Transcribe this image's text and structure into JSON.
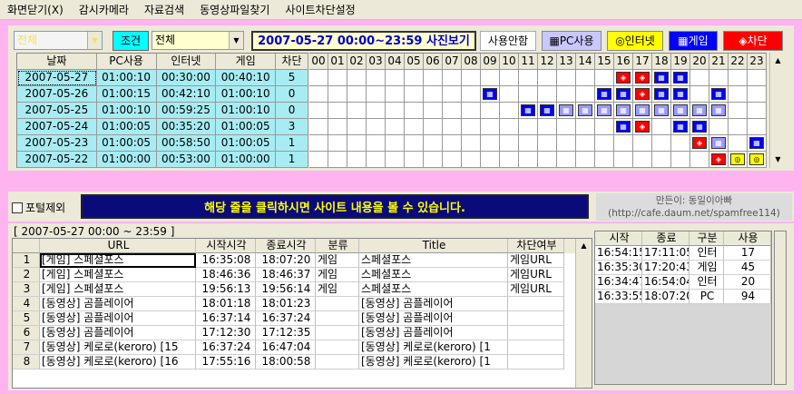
{
  "menu": [
    "화면닫기(X)",
    "감시카메라",
    "자료검색",
    "동영상파일찾기",
    "사이트차단설정"
  ],
  "toolbar": {
    "filter_value": "전체",
    "condition_label": "조건",
    "condition_value": "전체",
    "date_range": "2007-05-27 00:00~23:59 사진보기",
    "legend_none": "사용안함",
    "legend_pc": "PC사용",
    "legend_internet": "인터넷",
    "legend_game": "게임",
    "legend_block": "차단"
  },
  "colors": {
    "pc": "#9999ff",
    "internet": "#ffff00",
    "game": "#0000ff",
    "block": "#ff0000",
    "date_cell": "#a7ecf3",
    "banner": "#0a0a7a"
  },
  "summary": {
    "headers": [
      "날짜",
      "PC사용",
      "인터넷",
      "게임",
      "차단"
    ],
    "rows": [
      [
        "2007-05-27",
        "01:00:10",
        "00:30:00",
        "00:40:10",
        "5"
      ],
      [
        "2007-05-26",
        "01:00:15",
        "00:42:10",
        "01:00:10",
        "0"
      ],
      [
        "2007-05-25",
        "01:00:10",
        "00:59:25",
        "01:00:10",
        "0"
      ],
      [
        "2007-05-24",
        "01:00:05",
        "00:35:20",
        "01:00:05",
        "3"
      ],
      [
        "2007-05-23",
        "01:00:05",
        "00:58:50",
        "01:00:05",
        "1"
      ],
      [
        "2007-05-22",
        "01:00:00",
        "00:53:00",
        "01:00:00",
        "1"
      ]
    ]
  },
  "hours": [
    "00",
    "01",
    "02",
    "03",
    "04",
    "05",
    "06",
    "07",
    "08",
    "09",
    "10",
    "11",
    "12",
    "13",
    "14",
    "15",
    "16",
    "17",
    "18",
    "19",
    "20",
    "21",
    "22",
    "23"
  ],
  "hour_marks": [
    {
      "16": "block",
      "17": "block",
      "18": "game",
      "19": "game"
    },
    {
      "09": "game",
      "15": "game",
      "16": "game",
      "17": "block",
      "18": "game",
      "19": "game",
      "21": "game"
    },
    {
      "11": "game",
      "12": "game",
      "13": "pc",
      "14": "pc",
      "15": "pc",
      "16": "pc",
      "17": "pc",
      "18": "pc",
      "19": "pc",
      "20": "pc",
      "21": "pc"
    },
    {
      "16": "game",
      "17": "block",
      "19": "game",
      "20": "game"
    },
    {
      "20": "block",
      "21": "pc",
      "23": "game"
    },
    {
      "21": "block",
      "22": "internet",
      "23": "internet"
    }
  ],
  "portal_exclude": "포털제외",
  "banner": "해당 줄을 클릭하시면 사이트 내용을 볼 수 있습니다.",
  "author_line1": "만든이: 동일이아빠",
  "author_line2": "(http://cafe.daum.net/spamfree114)",
  "detail": {
    "range_label": "[ 2007-05-27 00:00 ~ 23:59 ]",
    "headers": [
      "",
      "URL",
      "시작시각",
      "종료시각",
      "분류",
      "Title",
      "차단여부"
    ],
    "rows": [
      [
        "1",
        "[게임] 스페셜포스",
        "16:35:08",
        "18:07:20",
        "게임",
        "스페셜포스",
        "게임URL"
      ],
      [
        "2",
        "[게임] 스페셜포스",
        "18:46:36",
        "18:46:37",
        "게임",
        "스페셜포스",
        "게임URL"
      ],
      [
        "3",
        "[게임] 스페셜포스",
        "19:56:13",
        "19:56:14",
        "게임",
        "스페셜포스",
        "게임URL"
      ],
      [
        "4",
        "[동영상] 곰플레이어",
        "18:01:18",
        "18:01:23",
        "",
        "[동영상] 곰플레이어",
        ""
      ],
      [
        "5",
        "[동영상] 곰플레이어",
        "16:37:14",
        "16:37:24",
        "",
        "[동영상] 곰플레이어",
        ""
      ],
      [
        "6",
        "[동영상] 곰플레이어",
        "17:12:30",
        "17:12:35",
        "",
        "[동영상] 곰플레이어",
        ""
      ],
      [
        "7",
        "[동영상] 케로로(keroro) [15",
        "16:37:24",
        "16:47:04",
        "",
        "[동영상] 케로로(keroro) [1",
        ""
      ],
      [
        "8",
        "[동영상] 케로로(keroro) [16",
        "17:55:16",
        "18:00:58",
        "",
        "[동영상] 케로로(keroro) [1",
        ""
      ]
    ]
  },
  "session": {
    "headers": [
      "시작",
      "종료",
      "구분",
      "사용"
    ],
    "rows": [
      [
        "16:54:15",
        "17:11:05",
        "인터",
        "17"
      ],
      [
        "16:35:30",
        "17:20:43",
        "게임",
        "45"
      ],
      [
        "16:34:47",
        "16:54:04",
        "인터",
        "20"
      ],
      [
        "16:33:55",
        "18:07:20",
        "PC",
        "94"
      ]
    ]
  }
}
